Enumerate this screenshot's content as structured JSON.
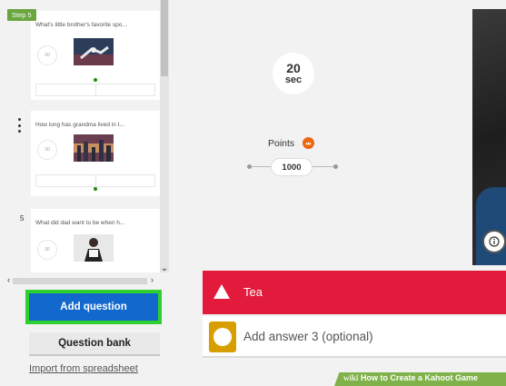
{
  "step_badge": "Step 5",
  "slides": [
    {
      "question": "What's little brother's favorite spo...",
      "time": "30",
      "number": ""
    },
    {
      "question": "How long has grandma lived in t...",
      "time": "30",
      "number": ""
    },
    {
      "question": "What did dad want to be when h...",
      "time": "30",
      "number": "5"
    }
  ],
  "scroll": {
    "left_arrow": "‹",
    "right_arrow": "›",
    "down_arrow": "⌄"
  },
  "buttons": {
    "add_question": "Add question",
    "question_bank": "Question bank",
    "import_spreadsheet": "Import from spreadsheet"
  },
  "timer": {
    "value": "20",
    "unit": "sec"
  },
  "points": {
    "label": "Points",
    "value": "1000"
  },
  "answers": [
    {
      "text": "Tea",
      "color": "#e21b3c",
      "shape": "triangle"
    },
    {
      "text": "Add answer 3 (optional)",
      "color": "#d89e00",
      "shape": "circle"
    }
  ],
  "watermark": {
    "brand": "wiki",
    "title": "How to Create a Kahoot Game"
  },
  "colors": {
    "accent_blue": "#1368ce",
    "highlight_green": "#2fcf2f",
    "red": "#e21b3c",
    "yellow": "#d89e00",
    "points_orange": "#eb670f"
  }
}
